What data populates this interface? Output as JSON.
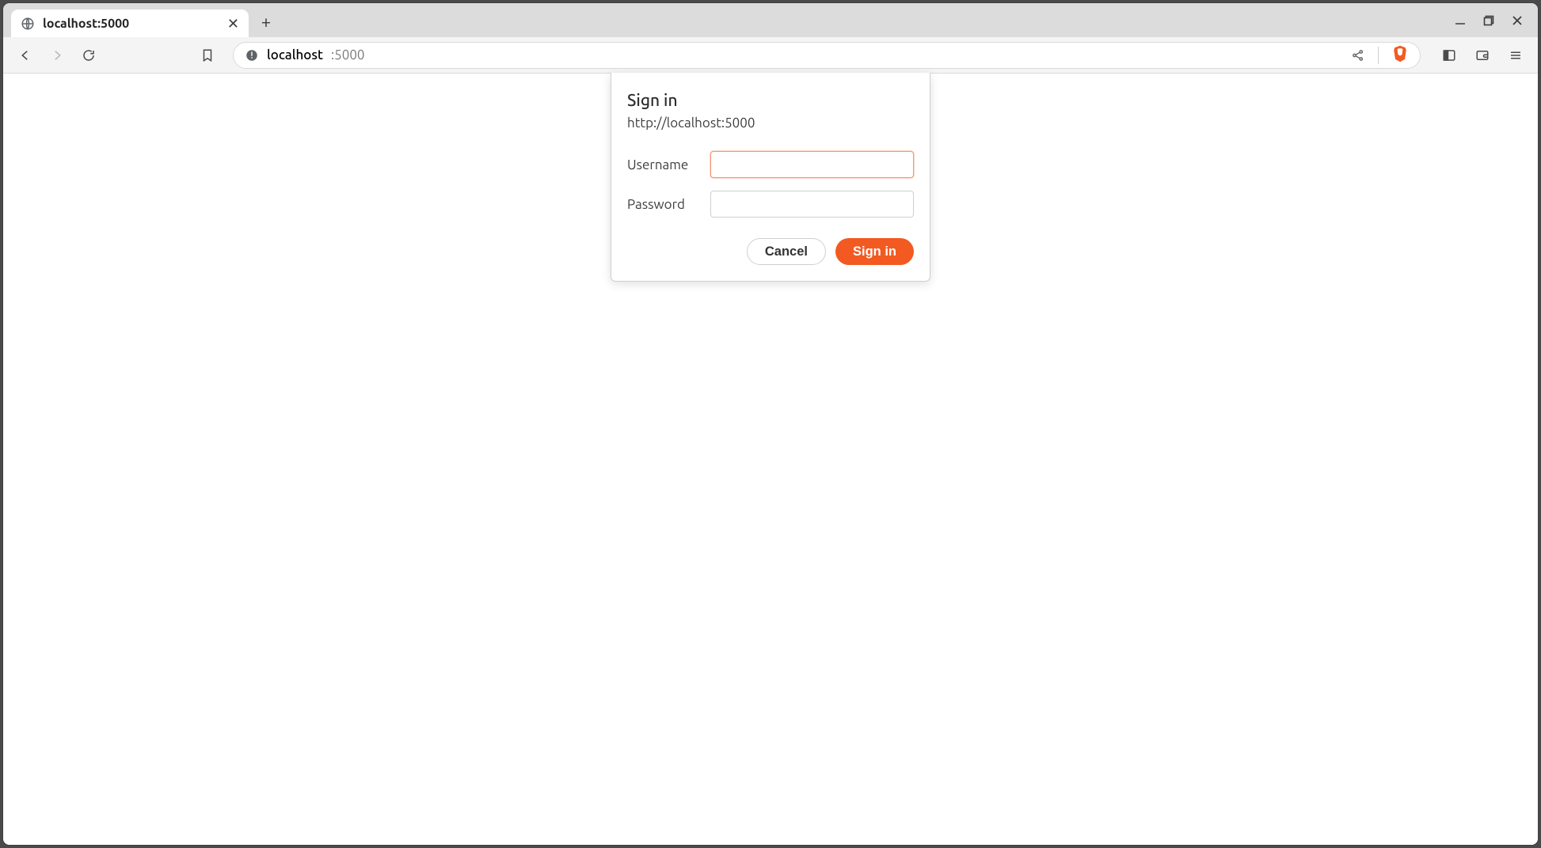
{
  "tab": {
    "title": "localhost:5000"
  },
  "address_bar": {
    "host": "localhost",
    "port": ":5000"
  },
  "dialog": {
    "title": "Sign in",
    "origin": "http://localhost:5000",
    "username_label": "Username",
    "password_label": "Password",
    "username_value": "",
    "password_value": "",
    "cancel_label": "Cancel",
    "signin_label": "Sign in"
  }
}
